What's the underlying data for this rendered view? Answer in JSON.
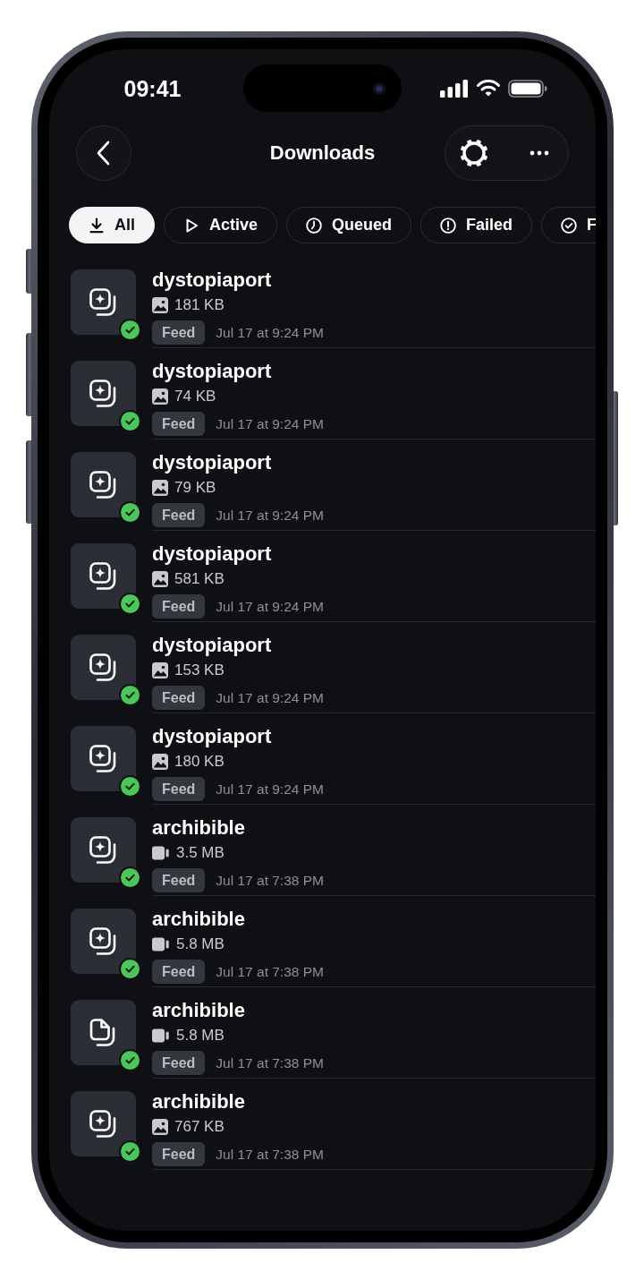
{
  "status_bar": {
    "time": "09:41"
  },
  "header": {
    "title": "Downloads"
  },
  "filters": [
    {
      "kind": "all",
      "label": "All",
      "selected": true
    },
    {
      "kind": "active",
      "label": "Active",
      "selected": false
    },
    {
      "kind": "queued",
      "label": "Queued",
      "selected": false
    },
    {
      "kind": "failed",
      "label": "Failed",
      "selected": false
    },
    {
      "kind": "done",
      "label": "F",
      "selected": false
    }
  ],
  "downloads": [
    {
      "kind": "image",
      "thumbnail": {
        "kind": "post"
      },
      "name": "dystopiaport",
      "size": "181 KB",
      "tag": "Feed",
      "date": "Jul 17 at 9:24 PM",
      "done": true
    },
    {
      "kind": "image",
      "thumbnail": {
        "kind": "post"
      },
      "name": "dystopiaport",
      "size": "74 KB",
      "tag": "Feed",
      "date": "Jul 17 at 9:24 PM",
      "done": true
    },
    {
      "kind": "image",
      "thumbnail": {
        "kind": "post"
      },
      "name": "dystopiaport",
      "size": "79 KB",
      "tag": "Feed",
      "date": "Jul 17 at 9:24 PM",
      "done": true
    },
    {
      "kind": "image",
      "thumbnail": {
        "kind": "post"
      },
      "name": "dystopiaport",
      "size": "581 KB",
      "tag": "Feed",
      "date": "Jul 17 at 9:24 PM",
      "done": true
    },
    {
      "kind": "image",
      "thumbnail": {
        "kind": "post"
      },
      "name": "dystopiaport",
      "size": "153 KB",
      "tag": "Feed",
      "date": "Jul 17 at 9:24 PM",
      "done": true
    },
    {
      "kind": "image",
      "thumbnail": {
        "kind": "post"
      },
      "name": "dystopiaport",
      "size": "180 KB",
      "tag": "Feed",
      "date": "Jul 17 at 9:24 PM",
      "done": true
    },
    {
      "kind": "video",
      "thumbnail": {
        "kind": "post"
      },
      "name": "archibible",
      "size": "3.5 MB",
      "tag": "Feed",
      "date": "Jul 17 at 7:38 PM",
      "done": true
    },
    {
      "kind": "video",
      "thumbnail": {
        "kind": "post"
      },
      "name": "archibible",
      "size": "5.8 MB",
      "tag": "Feed",
      "date": "Jul 17 at 7:38 PM",
      "done": true
    },
    {
      "kind": "video",
      "thumbnail": {
        "kind": "file"
      },
      "name": "archibible",
      "size": "5.8 MB",
      "tag": "Feed",
      "date": "Jul 17 at 7:38 PM",
      "done": true
    },
    {
      "kind": "image",
      "thumbnail": {
        "kind": "post"
      },
      "name": "archibible",
      "size": "767 KB",
      "tag": "Feed",
      "date": "Jul 17 at 7:38 PM",
      "done": true
    }
  ]
}
